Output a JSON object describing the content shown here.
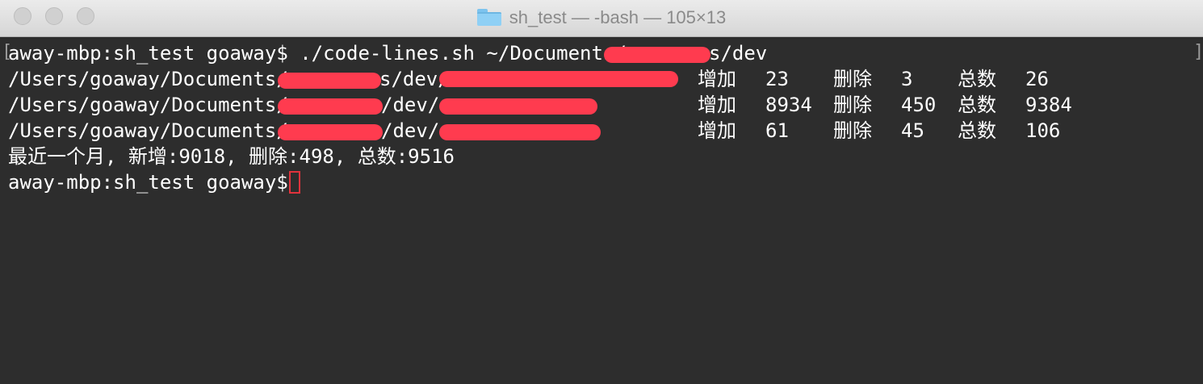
{
  "window": {
    "title": "sh_test — -bash — 105×13",
    "title_icon": "folder-icon"
  },
  "terminal": {
    "prompt": "away-mbp:sh_test goaway$",
    "command_line": {
      "prefix": "away-mbp:sh_test goaway$ ./code-lines.sh ~/Documents/",
      "suffix": "s/dev"
    },
    "rows": [
      {
        "path_prefix": "/Users/goaway/Documents/",
        "path_mid": "s/dev/",
        "label_add": "增加",
        "add": "23",
        "label_del": "删除",
        "del": "3",
        "label_total": "总数",
        "total": "26"
      },
      {
        "path_prefix": "/Users/goaway/Documents/",
        "path_mid": "/dev/",
        "label_add": "增加",
        "add": "8934",
        "label_del": "删除",
        "del": "450",
        "label_total": "总数",
        "total": "9384"
      },
      {
        "path_prefix": "/Users/goaway/Documents/",
        "path_mid": "/dev/",
        "label_add": "增加",
        "add": "61",
        "label_del": "删除",
        "del": "45",
        "label_total": "总数",
        "total": "106"
      }
    ],
    "summary": "最近一个月, 新增:9018, 删除:498, 总数:9516",
    "bracket_left": "[",
    "bracket_right": "]"
  },
  "colors": {
    "background": "#2d2d2d",
    "text": "#ffffff",
    "redaction": "#ff3b4f",
    "cursor": "#e0333c"
  }
}
